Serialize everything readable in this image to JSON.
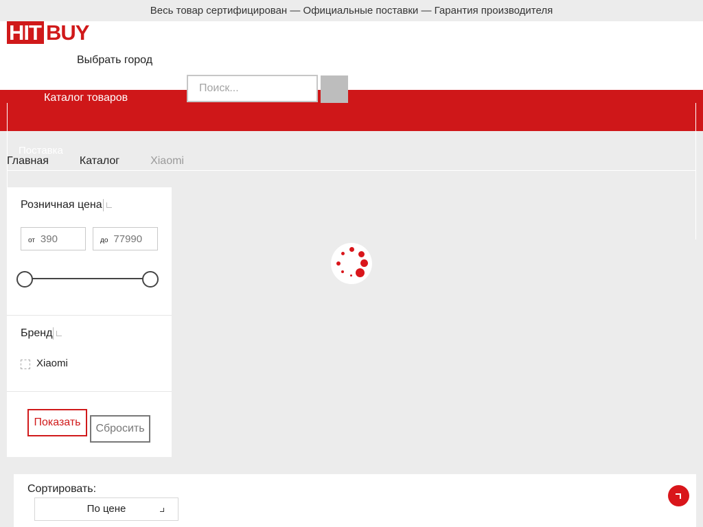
{
  "topbar": {
    "text": "Весь товар сертифицирован — Официальные поставки — Гарантия производителя"
  },
  "header": {
    "logo_hit": "HIT",
    "logo_buy": "BUY",
    "city_label": "Выбрать город",
    "search_placeholder": "Поиск..."
  },
  "nav": {
    "catalog_label": "Каталог товаров",
    "delivery_label": "Поставка"
  },
  "breadcrumb": [
    "Главная",
    "Каталог",
    "Xiaomi"
  ],
  "filter": {
    "price_title": "Розничная цена",
    "price_from_label": "от",
    "price_to_label": "до",
    "price_min_placeholder": "390",
    "price_max_placeholder": "77990",
    "slider_range": [
      390,
      77990
    ],
    "brand_title": "Бренд",
    "brands": [
      {
        "label": "Xiaomi",
        "checked": false
      }
    ],
    "show_label": "Показать",
    "reset_label": "Сбросить"
  },
  "sort": {
    "label": "Сортировать:",
    "selected": "По цене"
  },
  "icons": {
    "search": "search-icon",
    "loading": "loading-spinner-icon",
    "scroll_top": "arrow-up-icon",
    "dropdown": "chevron-down-icon"
  },
  "colors": {
    "brand_red": "#d0191a",
    "nav_red": "#cf1719",
    "page_bg": "#ececec"
  }
}
